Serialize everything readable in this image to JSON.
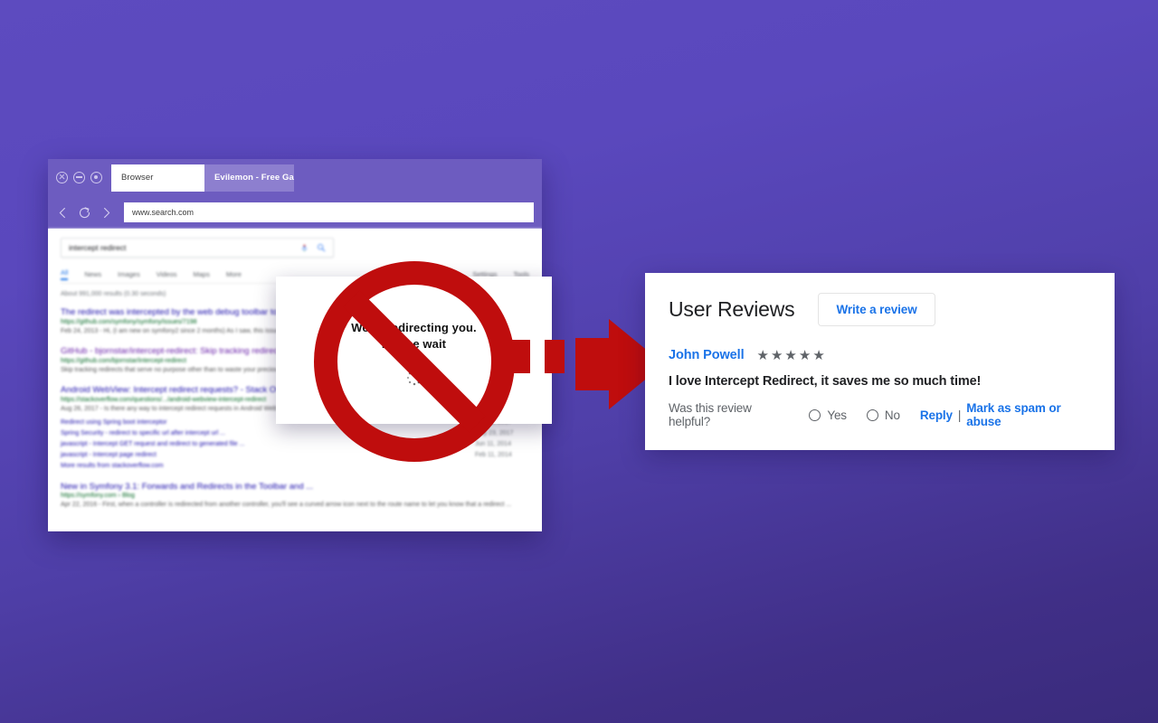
{
  "background": {
    "gradient_from": "#5d4bbf",
    "gradient_to": "#3a2b7c"
  },
  "browser": {
    "window_controls": [
      "close-icon",
      "minimize-icon",
      "maximize-icon"
    ],
    "tabs": [
      {
        "label": "Browser",
        "active": true
      },
      {
        "label": "Evilemon - Free Gam...",
        "active": false
      }
    ],
    "nav": {
      "back_icon": "back-arrow-icon",
      "reload_icon": "reload-icon",
      "forward_icon": "forward-arrow-icon",
      "url": "www.search.com"
    },
    "search_page": {
      "query": "intercept redirect",
      "mic_icon": "microphone-icon",
      "search_icon": "search-icon",
      "nav_tabs": [
        "All",
        "News",
        "Images",
        "Videos",
        "Maps",
        "More"
      ],
      "active_nav_tab": "All",
      "right_tools": [
        "Settings",
        "Tools"
      ],
      "result_count": "About 991,000 results (0.30 seconds)",
      "results": [
        {
          "title": "The redirect was intercepted by the web debug toolbar to ...",
          "url": "https://github.com/symfony/symfony/issues/7198",
          "snippet": "Feb 24, 2013 - Hi, (I am new on symfony2 since 2 months) As I saw, this issue was raised a long time ago, and was believed beeing resolved but I ...",
          "visited": false
        },
        {
          "title": "GitHub - bjornstar/intercept-redirect: Skip tracking redirects",
          "url": "https://github.com/bjornstar/intercept-redirect",
          "snippet": "Skip tracking redirects that serve no purpose other than to waste your precious time. bjornstar/intercept-redirect.",
          "visited": true
        },
        {
          "title": "Android WebView: Intercept redirect requests? - Stack Ov...",
          "url": "https://stackoverflow.com/questions/.../android-webview-intercept-redirect",
          "snippet": "Aug 26, 2017 - Is there any way to intercept redirect requests in Android WebView? shouldInterceptRequest(WebView,WebResourceRequest) does not seem ...",
          "visited": false,
          "sitelinks": [
            {
              "name": "Redirect using Spring boot interceptor",
              "date": "Jun 24, 2017"
            },
            {
              "name": "Spring Security - redirect to specific url after intercept url ...",
              "date": "May 23, 2017"
            },
            {
              "name": "javascript - Intercept GET request and redirect to generated file ...",
              "date": "Jun 11, 2014"
            },
            {
              "name": "javascript - Intercept page redirect",
              "date": "Feb 11, 2014"
            }
          ],
          "more_results": "More results from stackoverflow.com"
        },
        {
          "title": "New in Symfony 3.1: Forwards and Redirects in the Toolbar and ...",
          "url": "https://symfony.com › Blog",
          "snippet": "Apr 22, 2016 - First, when a controller is redirected from another controller, you'll see a curved arrow icon next to the route name to let you know that a redirect ...",
          "visited": false
        }
      ]
    }
  },
  "redirect_dialog": {
    "line1": "We’re redirecting you.",
    "line2": "Please wait",
    "spinner_icon": "loading-spinner-icon"
  },
  "prohibition": {
    "icon": "prohibition-no-entry-icon",
    "color": "#bf0d0d"
  },
  "arrow": {
    "icon": "right-arrow-icon",
    "color": "#bf0d0d"
  },
  "reviews": {
    "title": "User Reviews",
    "write_review_label": "Write a review",
    "review": {
      "author": "John Powell",
      "rating": 5,
      "star_glyph": "★",
      "text": "I love Intercept Redirect, it saves me so much time!",
      "helpful_label": "Was this review helpful?",
      "yes_label": "Yes",
      "no_label": "No",
      "reply_label": "Reply",
      "separator": "|",
      "spam_label": "Mark as spam or abuse"
    }
  }
}
